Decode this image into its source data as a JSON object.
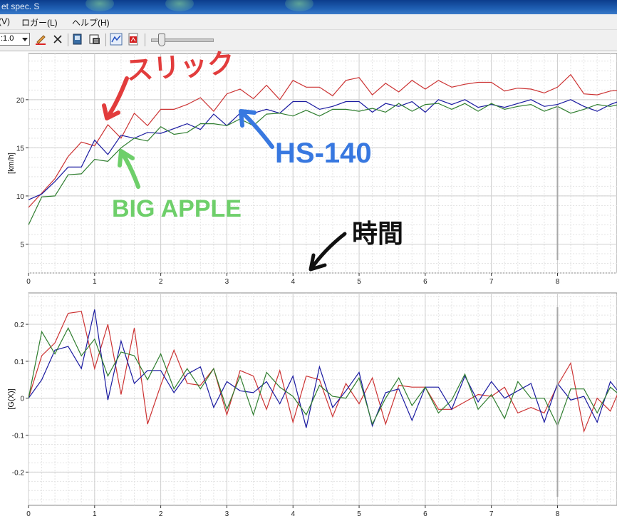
{
  "window": {
    "title": "et spec. S"
  },
  "menu": {
    "items": [
      "(V)",
      "ロガー(L)",
      "ヘルプ(H)"
    ]
  },
  "toolbar": {
    "zoom_value": ":1.0",
    "icons": [
      "pen-icon",
      "delete-icon",
      "export-icon",
      "save-icon",
      "graph-icon",
      "pdf-icon"
    ]
  },
  "annotations": {
    "slick": "スリック",
    "hs140": "HS-140",
    "bigapple": "BIG APPLE",
    "time": "時間"
  },
  "colors": {
    "series_red": "#cc3333",
    "series_blue": "#1a1aa0",
    "series_green": "#2e7d2e",
    "annot_red": "#e23c3c",
    "annot_blue": "#3878e0",
    "annot_green": "#6ecf6a",
    "annot_black": "#111111"
  },
  "chart_data": [
    {
      "type": "line",
      "title": "",
      "xlabel": "",
      "ylabel": "[km/h]",
      "xlim": [
        0,
        8.9
      ],
      "ylim": [
        2,
        24.8
      ],
      "xticks": [
        "0",
        "1",
        "2",
        "3",
        "4",
        "5",
        "6",
        "7",
        "8"
      ],
      "yticks": [
        "5",
        "10",
        "15",
        "20"
      ],
      "grid": true,
      "marker_x": 8.0,
      "x": [
        0,
        0.2,
        0.4,
        0.6,
        0.8,
        1.0,
        1.2,
        1.4,
        1.6,
        1.8,
        2.0,
        2.2,
        2.4,
        2.6,
        2.8,
        3.0,
        3.2,
        3.4,
        3.6,
        3.8,
        4.0,
        4.2,
        4.4,
        4.6,
        4.8,
        5.0,
        5.2,
        5.4,
        5.6,
        5.8,
        6.0,
        6.2,
        6.4,
        6.6,
        6.8,
        7.0,
        7.2,
        7.4,
        7.6,
        7.8,
        8.0,
        8.2,
        8.4,
        8.6,
        8.8,
        9.0
      ],
      "series": [
        {
          "color": "#cc3333",
          "values": [
            8.8,
            10.3,
            11.8,
            14.1,
            15.6,
            15.2,
            17.4,
            16.0,
            18.6,
            17.3,
            19.0,
            19.0,
            19.5,
            20.2,
            18.8,
            20.6,
            21.1,
            20.1,
            21.5,
            20.0,
            22.0,
            21.3,
            21.3,
            20.4,
            22.0,
            22.3,
            20.5,
            21.7,
            20.8,
            22.0,
            21.1,
            22.0,
            21.3,
            21.6,
            21.8,
            21.8,
            20.9,
            21.2,
            21.1,
            20.7,
            21.3,
            22.6,
            20.6,
            20.5,
            20.9,
            21.0
          ]
        },
        {
          "color": "#1a1aa0",
          "values": [
            9.6,
            10.2,
            11.5,
            13.0,
            13.0,
            15.8,
            14.3,
            16.3,
            16.0,
            16.6,
            16.5,
            17.0,
            17.5,
            16.9,
            18.5,
            17.3,
            18.6,
            18.6,
            19.0,
            18.6,
            19.8,
            19.8,
            19.0,
            19.3,
            19.8,
            19.8,
            18.7,
            19.6,
            19.3,
            19.8,
            18.7,
            20.0,
            19.5,
            20.0,
            19.2,
            19.5,
            19.2,
            19.6,
            20.0,
            19.3,
            19.5,
            20.0,
            19.3,
            18.8,
            19.5,
            20.0
          ]
        },
        {
          "color": "#2e7d2e",
          "values": [
            7.0,
            9.9,
            10.0,
            12.2,
            12.3,
            13.8,
            13.6,
            15.0,
            16.0,
            15.7,
            17.2,
            16.4,
            16.6,
            17.5,
            17.5,
            17.3,
            18.0,
            17.3,
            18.5,
            18.6,
            18.3,
            18.9,
            18.3,
            19.0,
            19.0,
            18.8,
            19.1,
            18.7,
            19.6,
            18.8,
            19.5,
            19.6,
            19.0,
            19.6,
            18.8,
            19.6,
            19.0,
            19.3,
            19.5,
            18.8,
            19.3,
            18.6,
            19.0,
            19.5,
            19.3,
            19.6
          ]
        }
      ]
    },
    {
      "type": "line",
      "title": "",
      "xlabel": "",
      "ylabel": "[G(X)]",
      "xlim": [
        0,
        8.9
      ],
      "ylim": [
        -0.29,
        0.285
      ],
      "xticks": [
        "0",
        "1",
        "2",
        "3",
        "4",
        "5",
        "6",
        "7",
        "8"
      ],
      "yticks": [
        "-0.2",
        "-0.1",
        "0",
        "0.1",
        "0.2"
      ],
      "grid": true,
      "marker_x": 8.0,
      "x": [
        0,
        0.2,
        0.4,
        0.6,
        0.8,
        1.0,
        1.2,
        1.4,
        1.6,
        1.8,
        2.0,
        2.2,
        2.4,
        2.6,
        2.8,
        3.0,
        3.2,
        3.4,
        3.6,
        3.8,
        4.0,
        4.2,
        4.4,
        4.6,
        4.8,
        5.0,
        5.2,
        5.4,
        5.6,
        5.8,
        6.0,
        6.2,
        6.4,
        6.6,
        6.8,
        7.0,
        7.2,
        7.4,
        7.6,
        7.8,
        8.0,
        8.2,
        8.4,
        8.6,
        8.8,
        9.0
      ],
      "series": [
        {
          "color": "#cc3333",
          "values": [
            0.0,
            0.115,
            0.15,
            0.23,
            0.235,
            0.08,
            0.2,
            0.01,
            0.19,
            -0.07,
            0.035,
            0.13,
            0.04,
            0.035,
            0.08,
            -0.045,
            0.075,
            0.06,
            -0.03,
            0.075,
            -0.065,
            0.06,
            0.05,
            -0.05,
            0.04,
            -0.015,
            0.055,
            -0.07,
            0.035,
            0.03,
            0.03,
            -0.03,
            -0.03,
            -0.01,
            0.01,
            0.005,
            0.03,
            -0.04,
            -0.025,
            -0.04,
            0.035,
            0.095,
            -0.09,
            0.0,
            -0.035,
            0.05
          ]
        },
        {
          "color": "#1a1aa0",
          "values": [
            0.0,
            0.05,
            0.13,
            0.14,
            0.08,
            0.24,
            -0.005,
            0.155,
            0.04,
            0.075,
            0.075,
            0.015,
            0.065,
            0.085,
            -0.025,
            0.045,
            0.02,
            0.015,
            0.045,
            -0.015,
            0.06,
            -0.08,
            0.085,
            -0.025,
            0.02,
            0.07,
            -0.075,
            0.015,
            0.025,
            -0.06,
            0.03,
            0.03,
            -0.03,
            0.06,
            -0.01,
            0.045,
            0.0,
            0.02,
            0.04,
            -0.065,
            0.04,
            -0.005,
            0.005,
            -0.065,
            0.045,
            0.0
          ]
        },
        {
          "color": "#2e7d2e",
          "values": [
            0.0,
            0.18,
            0.12,
            0.19,
            0.115,
            0.16,
            0.06,
            0.125,
            0.115,
            0.05,
            0.12,
            0.025,
            0.08,
            0.025,
            0.08,
            -0.03,
            0.06,
            -0.045,
            0.07,
            0.03,
            0.005,
            -0.045,
            0.035,
            0.005,
            0.0,
            0.055,
            -0.07,
            0.0,
            0.055,
            -0.02,
            0.03,
            -0.04,
            -0.005,
            0.065,
            -0.03,
            0.01,
            -0.055,
            0.045,
            0.0,
            0.0,
            -0.075,
            0.025,
            0.025,
            -0.04,
            0.03,
            0.0
          ]
        }
      ]
    }
  ]
}
